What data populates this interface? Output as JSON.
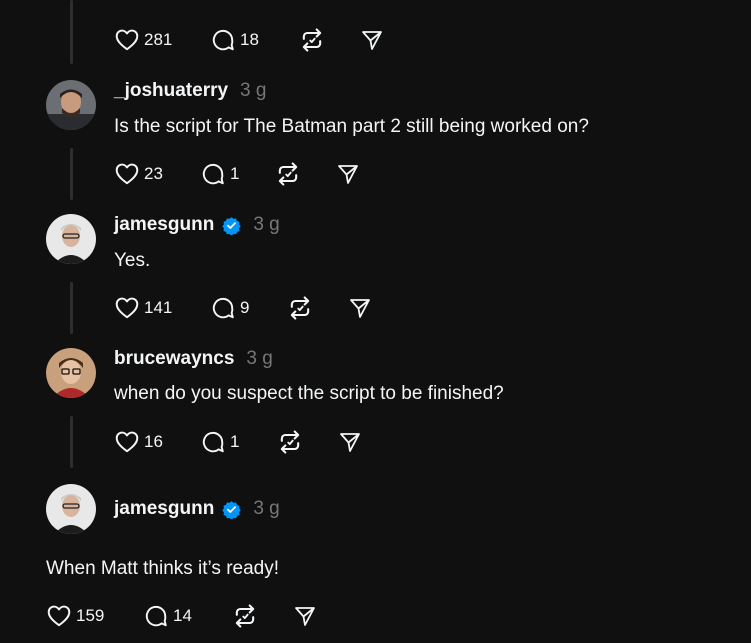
{
  "top_actions": {
    "likes": "281",
    "replies": "18"
  },
  "posts": [
    {
      "username": "_joshuaterry",
      "time": "3 g",
      "verified": false,
      "text": "Is the script for The Batman part 2 still being worked on?",
      "likes": "23",
      "replies": "1"
    },
    {
      "username": "jamesgunn",
      "time": "3 g",
      "verified": true,
      "text": "Yes.",
      "likes": "141",
      "replies": "9"
    },
    {
      "username": "brucewayncs",
      "time": "3 g",
      "verified": false,
      "text": "when do you suspect the script to be finished?",
      "likes": "16",
      "replies": "1"
    },
    {
      "username": "jamesgunn",
      "time": "3 g",
      "verified": true,
      "text": "When Matt thinks it’s ready!",
      "likes": "159",
      "replies": "14"
    }
  ],
  "icons": {
    "like": "heart-icon",
    "reply": "comment-icon",
    "repost": "repost-icon",
    "share": "send-icon",
    "verified": "verified-badge-icon"
  },
  "colors": {
    "background": "#101010",
    "text": "#f3f5f7",
    "muted": "#777777",
    "verified": "#0095f6",
    "thread_line": "#2e2e2e"
  }
}
